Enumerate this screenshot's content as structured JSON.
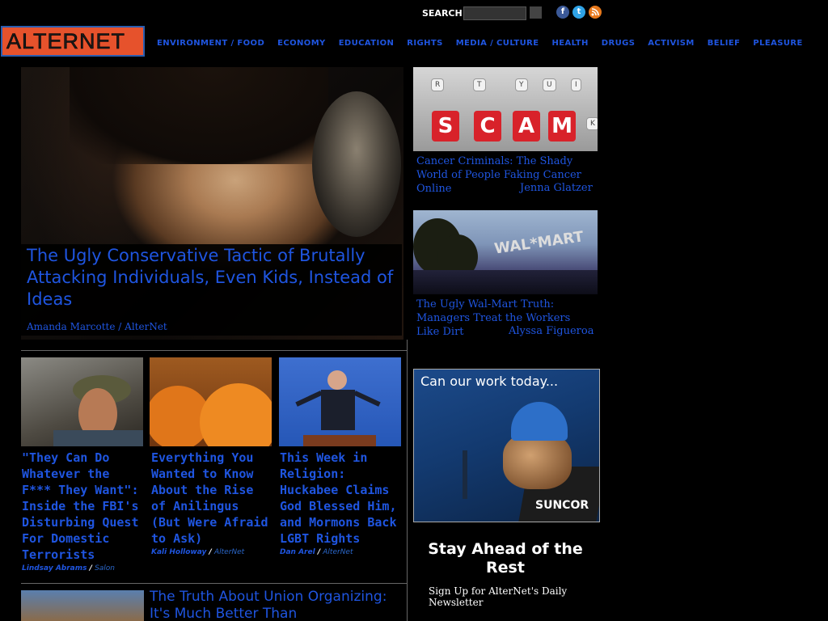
{
  "search": {
    "label": "SEARCH",
    "placeholder": ""
  },
  "social": {
    "facebook": "f",
    "twitter": "t",
    "rss": "rss"
  },
  "logo": {
    "text": "ALTERNET"
  },
  "nav": [
    "ENVIRONMENT / FOOD",
    "ECONOMY",
    "EDUCATION",
    "RIGHTS",
    "MEDIA / CULTURE",
    "HEALTH",
    "DRUGS",
    "ACTIVISM",
    "BELIEF",
    "PLEASURE"
  ],
  "hero": {
    "title": "The Ugly Conservative Tactic of Brutally Attacking Individuals, Even Kids, Instead of Ideas",
    "author": "Amanda Marcotte",
    "publication": "AlterNet"
  },
  "side_stories": [
    {
      "title": "Cancer Criminals: The Shady World of People Faking Cancer Online",
      "author": "Jenna Glatzer",
      "image_keys": [
        "R",
        "T",
        "Y",
        "U",
        "I",
        "S",
        "C",
        "A",
        "M",
        "K"
      ]
    },
    {
      "title": "The Ugly Wal-Mart Truth: Managers Treat the Workers Like Dirt",
      "author": "Alyssa Figueroa",
      "image_sign": "WAL*MART"
    }
  ],
  "ad": {
    "headline": "Can our work today...",
    "brand": "SUNCOR"
  },
  "newsletter": {
    "title": "Stay Ahead of the Rest",
    "subtitle": "Sign Up for AlterNet's Daily Newsletter"
  },
  "cards": [
    {
      "title": "\"They Can Do Whatever the F*** They Want\": Inside the FBI's Disturbing Quest For Domestic Terrorists",
      "author": "Lindsay Abrams",
      "publication": "Salon"
    },
    {
      "title": "Everything You Wanted to Know About the Rise of Anilingus (But Were Afraid to Ask)",
      "author": "Kali Holloway",
      "publication": "AlterNet"
    },
    {
      "title": "This Week in Religion: Huckabee Claims God Blessed Him, and Mormons Back LGBT Rights",
      "author": "Dan Arel",
      "publication": "AlterNet"
    }
  ],
  "bottom_story": {
    "title": "The Truth About Union Organizing: It's Much Better Than"
  },
  "separators": {
    "slash": "/"
  },
  "colors": {
    "link": "#1f55e0",
    "logo_bg": "#e6522c",
    "background": "#000000"
  }
}
